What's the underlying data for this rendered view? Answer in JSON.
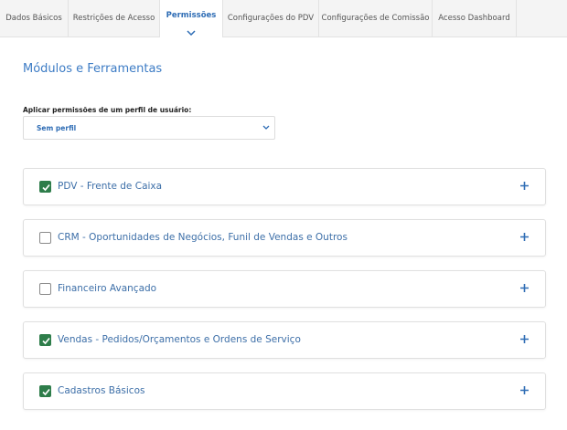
{
  "tabs": [
    {
      "label": "Dados Básicos",
      "active": false
    },
    {
      "label": "Restrições de Acesso",
      "active": false
    },
    {
      "label": "Permissões",
      "active": true
    },
    {
      "label": "Configurações do PDV",
      "active": false
    },
    {
      "label": "Configurações de Comissão",
      "active": false
    },
    {
      "label": "Acesso Dashboard",
      "active": false
    }
  ],
  "section_title": "Módulos e Ferramentas",
  "profile": {
    "label": "Aplicar permissões de um perfil de usuário:",
    "selected": "Sem perfil"
  },
  "modules": [
    {
      "label": "PDV - Frente de Caixa",
      "checked": true
    },
    {
      "label": "CRM - Oportunidades de Negócios, Funil de Vendas e Outros",
      "checked": false
    },
    {
      "label": "Financeiro Avançado",
      "checked": false
    },
    {
      "label": "Vendas - Pedidos/Orçamentos e Ordens de Serviço",
      "checked": true
    },
    {
      "label": "Cadastros Básicos",
      "checked": true
    }
  ],
  "colors": {
    "accent": "#2f6db5",
    "checkbox_checked": "#2e7d4a"
  },
  "icons": {
    "active_tab_indicator": "chevron-down-icon",
    "select_caret": "chevron-down-icon",
    "expand": "plus-icon",
    "check": "check-icon"
  }
}
